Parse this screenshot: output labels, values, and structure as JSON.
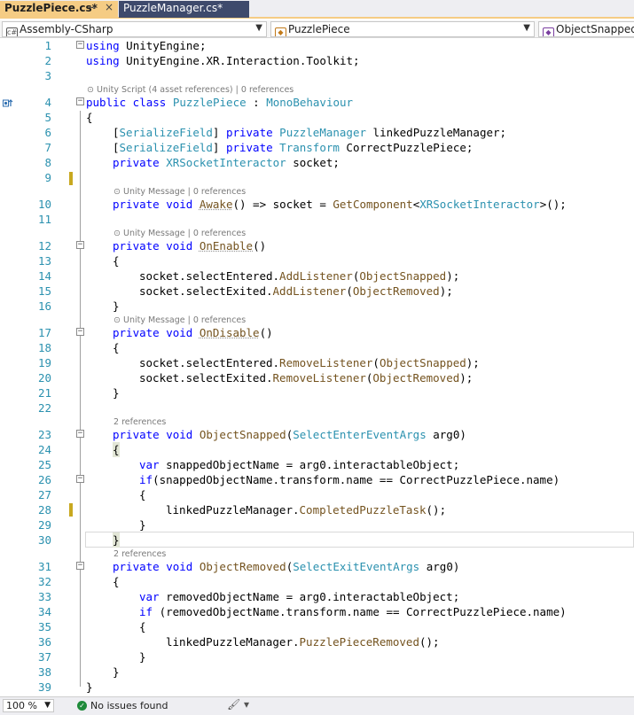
{
  "tabs": [
    {
      "label": "PuzzlePiece.cs*",
      "pin": "⊸",
      "close": "×"
    },
    {
      "label": "PuzzleManager.cs*"
    }
  ],
  "nav": {
    "project": "Assembly-CSharp",
    "type": "PuzzlePiece",
    "member": "ObjectSnapped(S"
  },
  "status": {
    "zoom": "100 %",
    "issues": "No issues found"
  },
  "lines": [
    {
      "n": "1"
    },
    {
      "n": "2"
    },
    {
      "n": "3"
    },
    {
      "n": "4"
    },
    {
      "n": "5"
    },
    {
      "n": "6"
    },
    {
      "n": "7"
    },
    {
      "n": "8"
    },
    {
      "n": "9"
    },
    {
      "n": "10"
    },
    {
      "n": "11"
    },
    {
      "n": "12"
    },
    {
      "n": "13"
    },
    {
      "n": "14"
    },
    {
      "n": "15"
    },
    {
      "n": "16"
    },
    {
      "n": "17"
    },
    {
      "n": "18"
    },
    {
      "n": "19"
    },
    {
      "n": "20"
    },
    {
      "n": "21"
    },
    {
      "n": "22"
    },
    {
      "n": "23"
    },
    {
      "n": "24"
    },
    {
      "n": "25"
    },
    {
      "n": "26"
    },
    {
      "n": "27"
    },
    {
      "n": "28"
    },
    {
      "n": "29"
    },
    {
      "n": "30"
    },
    {
      "n": "31"
    },
    {
      "n": "32"
    },
    {
      "n": "33"
    },
    {
      "n": "34"
    },
    {
      "n": "35"
    },
    {
      "n": "36"
    },
    {
      "n": "37"
    },
    {
      "n": "38"
    },
    {
      "n": "39"
    }
  ],
  "code": {
    "l1_kw": "using",
    "l1_rest": " UnityEngine;",
    "l2_kw": "using",
    "l2_rest": " UnityEngine.XR.Interaction.Toolkit;",
    "lens4": "Unity Script (4 asset references) | 0 references",
    "l4_kw": "public class",
    "l4_sp": " ",
    "l4_cls": "PuzzlePiece",
    "l4_colon": " : ",
    "l4_base": "MonoBehaviour",
    "l5": "{",
    "l6_attr": "SerializeField",
    "l6_kw": "private",
    "l6_ty": "PuzzleManager",
    "l6_rest": " linkedPuzzleManager;",
    "l7_attr": "SerializeField",
    "l7_kw": "private",
    "l7_ty": "Transform",
    "l7_rest": " CorrectPuzzlePiece;",
    "l8_kw": "private",
    "l8_ty": "XRSocketInteractor",
    "l8_rest": " socket;",
    "lens10": "Unity Message | 0 references",
    "l10_kw": "private void",
    "l10_me": "Awake",
    "l10_mid": "() => socket = ",
    "l10_gc": "GetComponent",
    "l10_lt": "<",
    "l10_ty": "XRSocketInteractor",
    "l10_end": ">();",
    "lens12": "Unity Message | 0 references",
    "l12_kw": "private void",
    "l12_me": "OnEnable",
    "l12_end": "()",
    "l13": "{",
    "l14_a": "socket.selectEntered.",
    "l14_me": "AddListener",
    "l14_p": "(",
    "l14_arg": "ObjectSnapped",
    "l14_end": ");",
    "l15_a": "socket.selectExited.",
    "l15_me": "AddListener",
    "l15_p": "(",
    "l15_arg": "ObjectRemoved",
    "l15_end": ");",
    "l16": "}",
    "lens17": "Unity Message | 0 references",
    "l17_kw": "private void",
    "l17_me": "OnDisable",
    "l17_end": "()",
    "l18": "{",
    "l19_a": "socket.selectEntered.",
    "l19_me": "RemoveListener",
    "l19_p": "(",
    "l19_arg": "ObjectSnapped",
    "l19_end": ");",
    "l20_a": "socket.selectExited.",
    "l20_me": "RemoveListener",
    "l20_p": "(",
    "l20_arg": "ObjectRemoved",
    "l20_end": ");",
    "l21": "}",
    "lens23": "2 references",
    "l23_kw": "private void",
    "l23_me": "ObjectSnapped",
    "l23_p": "(",
    "l23_ty": "SelectEnterEventArgs",
    "l23_end": " arg0)",
    "l24": "{",
    "l25_kw": "var",
    "l25_rest": " snappedObjectName = arg0.interactableObject;",
    "l26_kw": "if",
    "l26_rest": "(snappedObjectName.transform.name == CorrectPuzzlePiece.name)",
    "l27": "{",
    "l28_a": "linkedPuzzleManager.",
    "l28_me": "CompletedPuzzleTask",
    "l28_end": "();",
    "l29": "}",
    "l30": "}",
    "lens31": "2 references",
    "l31_kw": "private void",
    "l31_me": "ObjectRemoved",
    "l31_p": "(",
    "l31_ty": "SelectExitEventArgs",
    "l31_end": " arg0)",
    "l32": "{",
    "l33_kw": "var",
    "l33_rest": " removedObjectName = arg0.interactableObject;",
    "l34_kw": "if",
    "l34_rest": " (removedObjectName.transform.name == CorrectPuzzlePiece.name)",
    "l35": "{",
    "l36_a": "linkedPuzzleManager.",
    "l36_me": "PuzzlePieceRemoved",
    "l36_end": "();",
    "l37": "}",
    "l38": "}",
    "l39": "}"
  },
  "colors": {
    "keyword": "#0000ff",
    "type": "#2b91af",
    "method": "#74531f",
    "line_number": "#2b91af",
    "active_tab": "#f5cc84",
    "inactive_tab": "#3e4a6c",
    "change_marker": "#c8a820"
  }
}
